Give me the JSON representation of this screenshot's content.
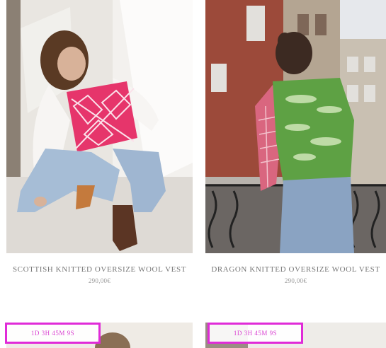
{
  "products": [
    {
      "title": "SCOTTISH KNITTED OVERSIZE WOOL VEST",
      "price": "290,00€",
      "image_alt": "woman crouching in pink argyle knit vest"
    },
    {
      "title": "DRAGON KNITTED OVERSIZE WOOL VEST",
      "price": "290,00€",
      "image_alt": "person on balcony in green knit vest"
    }
  ],
  "promo": {
    "left_label": "1D 3H 45M 9S",
    "right_label": "1D 3H 45M 9S"
  },
  "colors": {
    "promo_border": "#e02bd8",
    "promo_text": "#d93fd1"
  }
}
